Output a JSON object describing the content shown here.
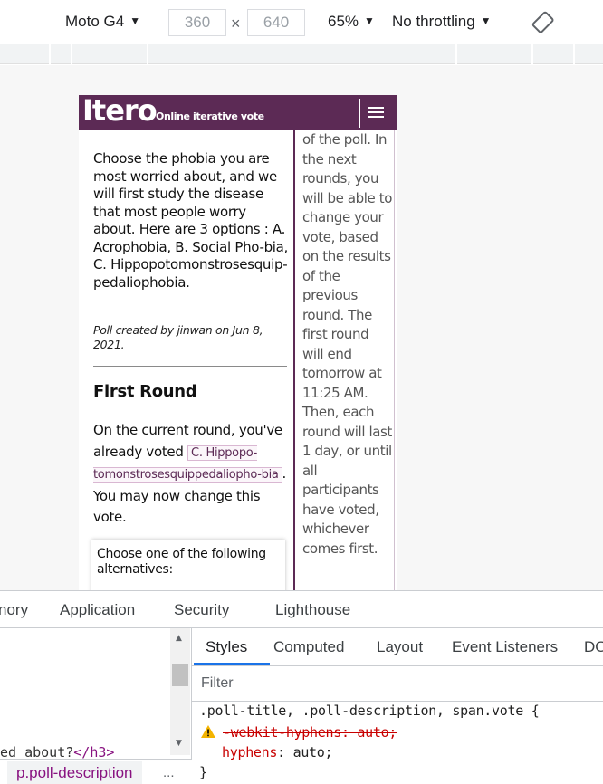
{
  "device_toolbar": {
    "device": "Moto G4",
    "width": "360",
    "height": "640",
    "times": "×",
    "zoom": "65%",
    "throttling": "No throttling"
  },
  "app": {
    "logo": "Itero",
    "tagline": "Online iterative vote",
    "description": "Choose the phobia you are most worried about, and we will first study the disease that most people worry about. Here are 3 options : A. Acrophobia, B. Social Pho-bia, C. Hippopotomonstrosesquip-pedaliophobia.",
    "meta": "Poll created by jinwan on Jun 8, 2021.",
    "round_title": "First Round",
    "current_prefix": "On the current round, you've already voted",
    "current_vote": "C. Hippopo-tomonstrosesquippedaliopho-bia",
    "current_suffix": ". You may now change this vote.",
    "alternatives_prompt": "Choose one of the following alternatives:",
    "side_text": "of the poll. In the next rounds, you will be able to change your vote, based on the results of the previous round. The first round will end tomorrow at 11:25 AM. Then, each round will last 1 day, or until all participants have voted, whichever comes first."
  },
  "devtools": {
    "tabs": [
      "nory",
      "Application",
      "Security",
      "Lighthouse"
    ],
    "element_code": "ed about?",
    "element_close_tag": "</h3>",
    "breadcrumb": "p.poll-description",
    "breadcrumb_more": "...",
    "sub_tabs": [
      "Styles",
      "Computed",
      "Layout",
      "Event Listeners",
      "DO"
    ],
    "filter_placeholder": "Filter",
    "rule_selector": ".poll-title, .poll-description, span.vote {",
    "rule_webkit_prop": "-webkit-hyphens: auto;",
    "rule_prop": "hyphens",
    "rule_value": "auto;",
    "rule_close": "}"
  },
  "colors": {
    "brand": "#5c2a55",
    "accent_tab": "#1a73e8",
    "css_prop": "#c80000",
    "tag": "#881280"
  }
}
